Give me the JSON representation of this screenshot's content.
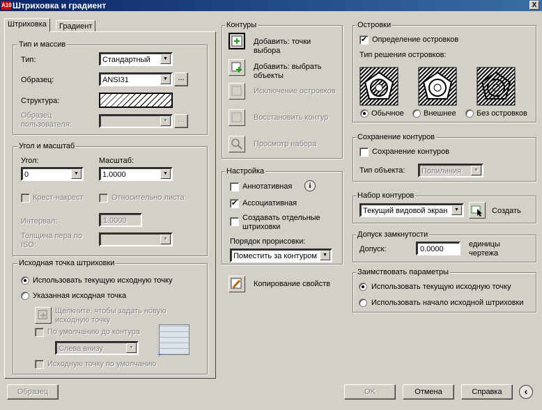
{
  "window": {
    "title": "Штриховка и градиент",
    "close": "X",
    "logo": "A10"
  },
  "tabs": [
    "Штриховка",
    "Градиент"
  ],
  "type_pattern": {
    "legend": "Тип и массив",
    "type_label": "Тип:",
    "type_value": "Стандартный",
    "pattern_label": "Образец:",
    "pattern_value": "ANSI31",
    "structure_label": "Структура:",
    "custom_label": "Образец пользователя:",
    "browse": "..."
  },
  "angle_scale": {
    "legend": "Угол и масштаб",
    "angle_label": "Угол:",
    "angle_value": "0",
    "scale_label": "Масштаб:",
    "scale_value": "1.0000",
    "double": "Крест-накрест",
    "relative": "Относительно листа",
    "spacing_label": "Интервал:",
    "spacing_value": "1.0000",
    "iso_label": "Толщина пера по ISO:"
  },
  "origin": {
    "legend": "Исходная точка штриховки",
    "use_current": "Использовать текущую исходную точку",
    "specified": "Указанная исходная точка",
    "click_set": "Щелкните, чтобы задать новую исходную точку",
    "default_extents": "По умолчанию до контура",
    "position": "Слева внизу",
    "store_default": "Исходную точку по умолчанию"
  },
  "boundaries": {
    "legend": "Контуры",
    "add_pick": "Добавить: точки выбора",
    "add_select": "Добавить: выбрать объекты",
    "remove_islands": "Исключение островков",
    "recreate": "Восстановить контур",
    "view_sel": "Просмотр набора"
  },
  "options": {
    "legend": "Настройка",
    "annotative": "Аннотативная",
    "associative": "Ассоциативная",
    "separate": "Создавать отдельные штриховки",
    "draw_order_label": "Порядок прорисовки:",
    "draw_order_value": "Поместить за контуром"
  },
  "inherit": "Копирование свойств",
  "islands": {
    "legend": "Островки",
    "detection": "Определение островков",
    "style_label": "Тип решения островков:",
    "normal": "Обычное",
    "outer": "Внешнее",
    "ignore": "Без островков"
  },
  "retain": {
    "legend": "Сохранение контуров",
    "retain": "Сохранение контуров",
    "obj_type_label": "Тип объекта:",
    "obj_type_value": "Полилиния"
  },
  "boundary_set": {
    "legend": "Набор контуров",
    "value": "Текущий видовой экран",
    "new": "Создать"
  },
  "gap": {
    "legend": "Допуск замкнутости",
    "label": "Допуск:",
    "value": "0.0000",
    "units": "единицы чертежа"
  },
  "inherit_opts": {
    "legend": "Заимствовать параметры",
    "use_current": "Использовать текущую исходную точку",
    "use_source": "Использовать начало исходной штриховки"
  },
  "footer": {
    "preview": "Образец",
    "ok": "OK",
    "cancel": "Отмена",
    "help": "Справка",
    "more": "‹"
  }
}
